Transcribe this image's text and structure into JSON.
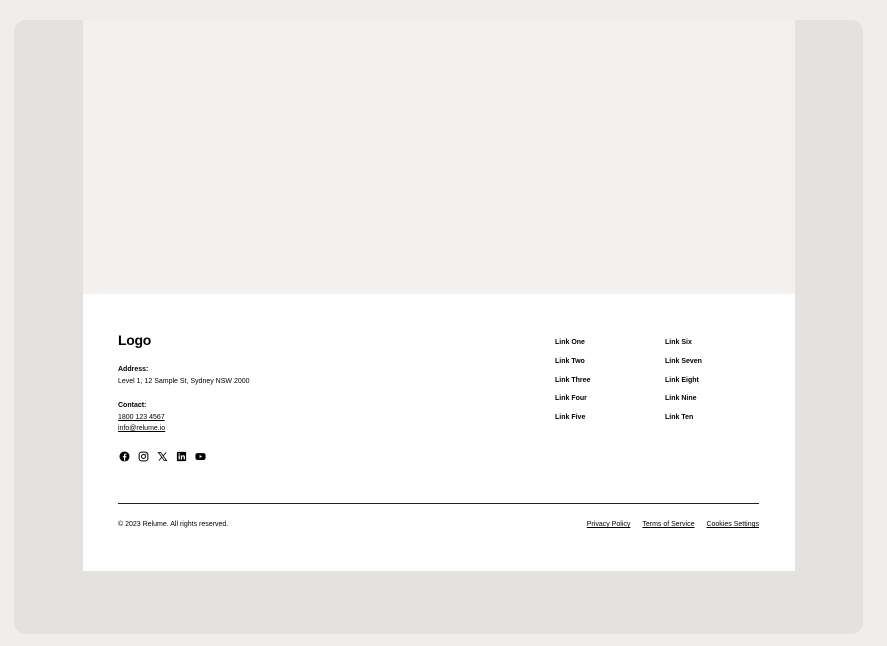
{
  "footer": {
    "logo": "Logo",
    "address_label": "Address:",
    "address_value": "Level 1, 12 Sample St, Sydney NSW 2000",
    "contact_label": "Contact:",
    "phone": "1800 123 4567",
    "email": "info@relume.io",
    "social_icons": [
      "facebook-icon",
      "instagram-icon",
      "x-icon",
      "linkedin-icon",
      "youtube-icon"
    ],
    "links_col1": [
      "Link One",
      "Link Two",
      "Link Three",
      "Link Four",
      "Link Five"
    ],
    "links_col2": [
      "Link Six",
      "Link Seven",
      "Link Eight",
      "Link Nine",
      "Link Ten"
    ],
    "copyright": "© 2023 Relume. All rights reserved.",
    "legal": [
      "Privacy Policy",
      "Terms of Service",
      "Cookies Settings"
    ]
  }
}
